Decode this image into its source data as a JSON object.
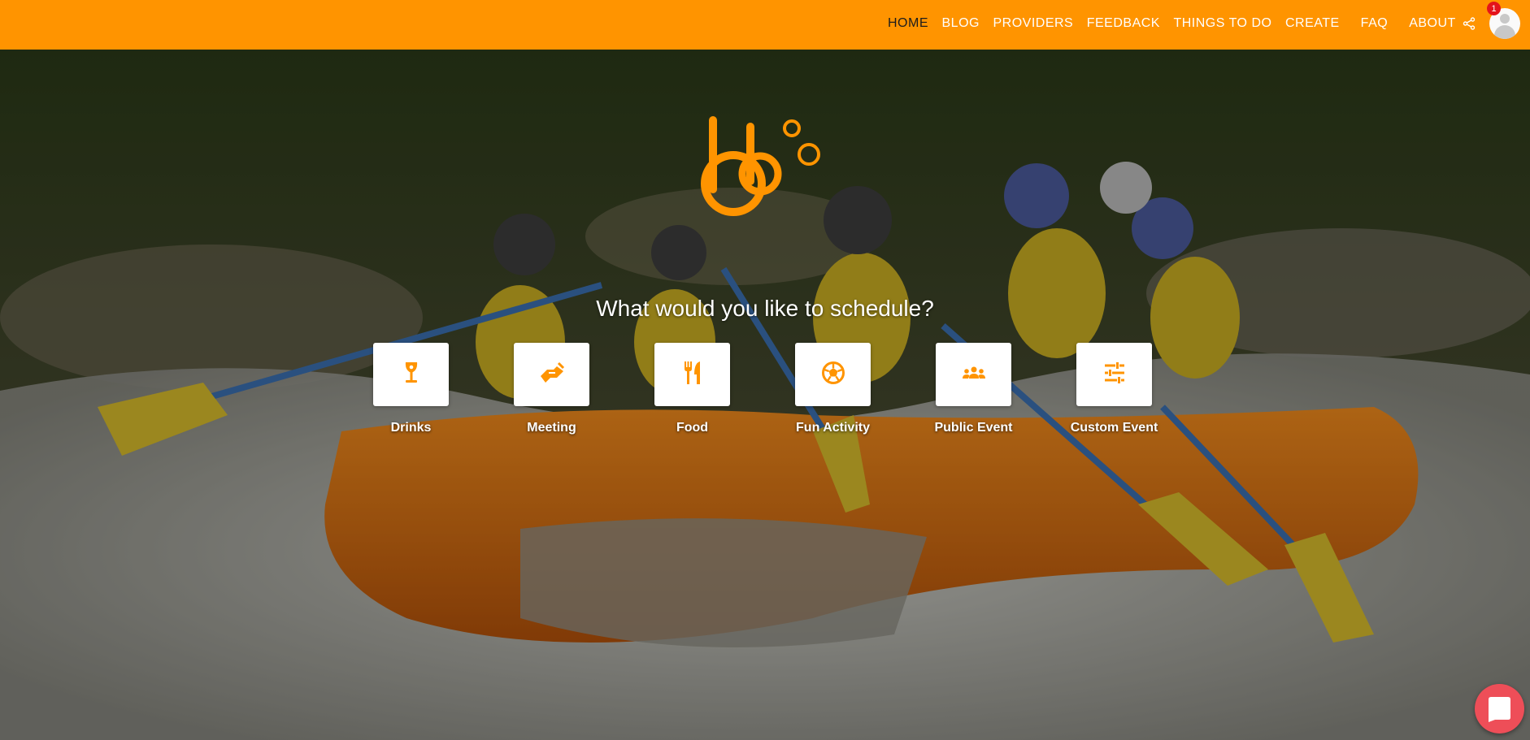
{
  "nav": {
    "items": [
      {
        "label": "HOME",
        "active": true
      },
      {
        "label": "BLOG",
        "active": false
      },
      {
        "label": "PROVIDERS",
        "active": false
      },
      {
        "label": "FEEDBACK",
        "active": false
      },
      {
        "label": "THINGS TO DO",
        "active": false
      },
      {
        "label": "CREATE",
        "active": false
      },
      {
        "label": "FAQ",
        "active": false
      },
      {
        "label": "ABOUT",
        "active": false
      }
    ],
    "share_icon": "share-icon",
    "notification_count": "1"
  },
  "hero": {
    "headline": "What would you like to schedule?",
    "tiles": [
      {
        "label": "Drinks",
        "icon": "wine-glass-icon"
      },
      {
        "label": "Meeting",
        "icon": "handshake-icon"
      },
      {
        "label": "Food",
        "icon": "fork-knife-icon"
      },
      {
        "label": "Fun Activity",
        "icon": "soccer-ball-icon"
      },
      {
        "label": "Public Event",
        "icon": "group-icon"
      },
      {
        "label": "Custom Event",
        "icon": "sliders-icon"
      }
    ]
  },
  "colors": {
    "brand": "#ff9400",
    "nav_active": "#1d1d1d",
    "badge": "#e4141b",
    "chat": "#ee4e58"
  }
}
